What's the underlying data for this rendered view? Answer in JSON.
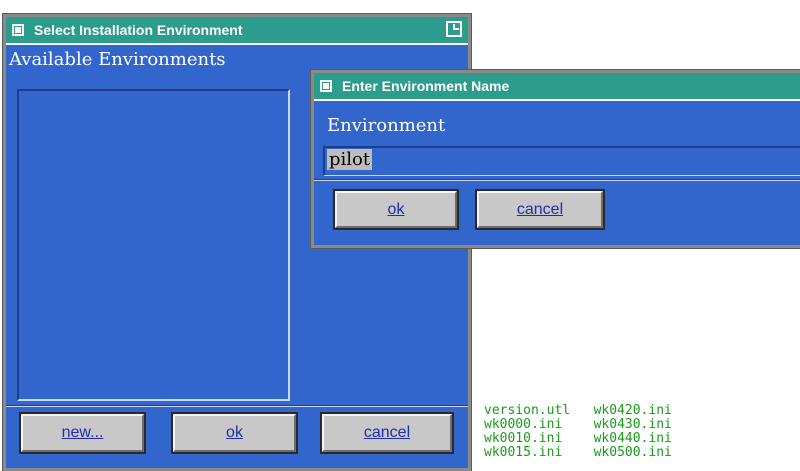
{
  "main_dialog": {
    "title": "Select Installation Environment",
    "list_label": "Available Environments",
    "buttons": {
      "new": "new...",
      "ok": "ok",
      "cancel": "cancel"
    }
  },
  "name_dialog": {
    "title": "Enter Environment Name",
    "field_label": "Environment",
    "field_value": "pilot",
    "buttons": {
      "ok": "ok",
      "cancel": "cancel"
    }
  },
  "terminal_files": [
    [
      "version.utl",
      "wk0420.ini"
    ],
    [
      "wk0000.ini",
      "wk0430.ini"
    ],
    [
      "wk0010.ini",
      "wk0440.ini"
    ],
    [
      "wk0015.ini",
      "wk0500.ini"
    ]
  ],
  "colors": {
    "window_bg": "#3366cc",
    "titlebar": "#2c9c8c",
    "button": "#c8c8c8",
    "terminal_text": "#1a9a1a"
  }
}
